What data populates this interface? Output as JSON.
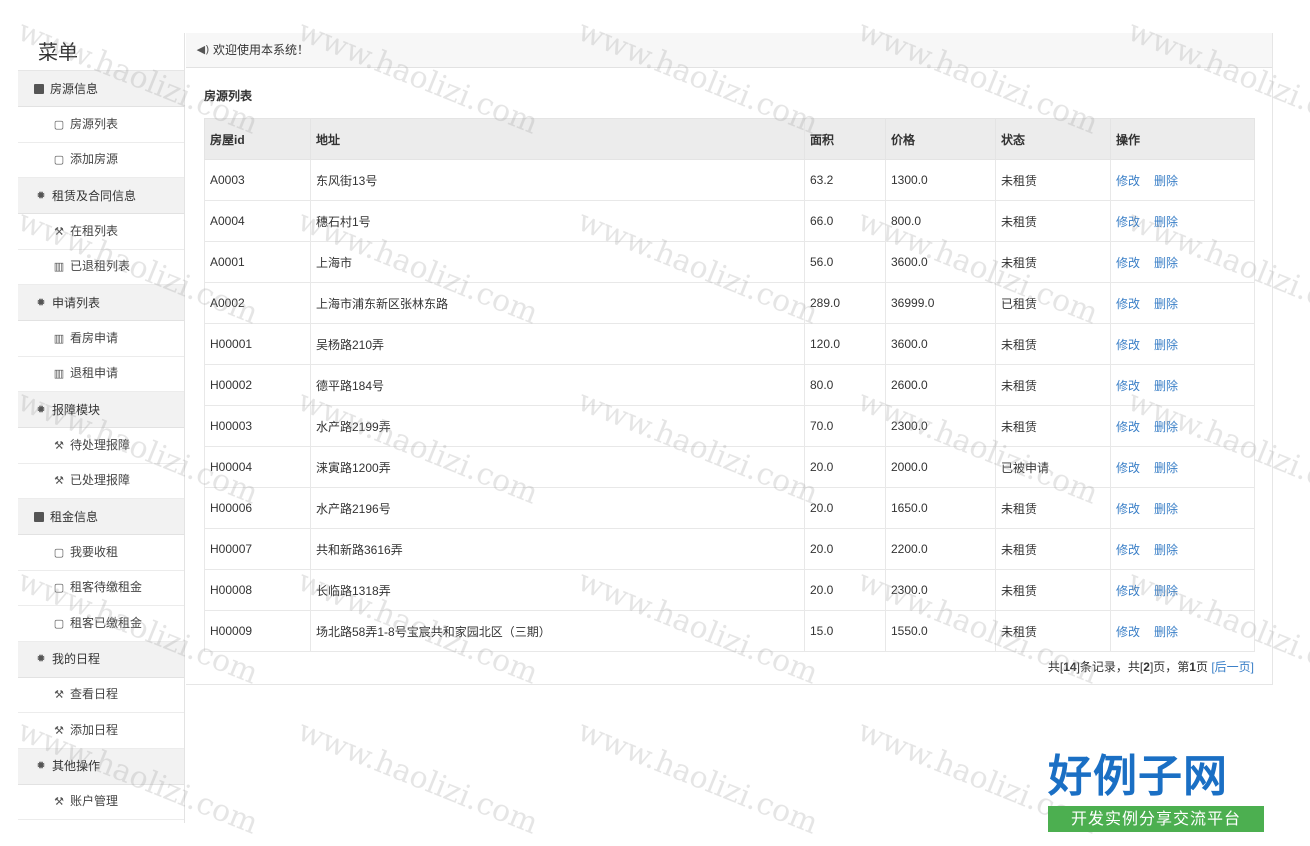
{
  "sidebar": {
    "title": "菜单",
    "groups": [
      {
        "label": "房源信息",
        "items": [
          "房源列表",
          "添加房源"
        ]
      },
      {
        "label": "租赁及合同信息",
        "items": [
          "在租列表",
          "已退租列表"
        ]
      },
      {
        "label": "申请列表",
        "items": [
          "看房申请",
          "退租申请"
        ]
      },
      {
        "label": "报障模块",
        "items": [
          "待处理报障",
          "已处理报障"
        ]
      },
      {
        "label": "租金信息",
        "items": [
          "我要收租",
          "租客待缴租金",
          "租客已缴租金"
        ]
      },
      {
        "label": "我的日程",
        "items": [
          "查看日程",
          "添加日程"
        ]
      },
      {
        "label": "其他操作",
        "items": [
          "账户管理"
        ]
      }
    ]
  },
  "topbar": {
    "welcome": "欢迎使用本系统！"
  },
  "main": {
    "section_title": "房源列表",
    "columns": [
      "房屋id",
      "地址",
      "面积",
      "价格",
      "状态",
      "操作"
    ],
    "rows": [
      [
        "A0003",
        "东风街13号",
        "63.2",
        "1300.0",
        "未租赁"
      ],
      [
        "A0004",
        "穗石村1号",
        "66.0",
        "800.0",
        "未租赁"
      ],
      [
        "A0001",
        "上海市",
        "56.0",
        "3600.0",
        "未租赁"
      ],
      [
        "A0002",
        "上海市浦东新区张林东路",
        "289.0",
        "36999.0",
        "已租赁"
      ],
      [
        "H00001",
        "吴杨路210弄",
        "120.0",
        "3600.0",
        "未租赁"
      ],
      [
        "H00002",
        "德平路184号",
        "80.0",
        "2600.0",
        "未租赁"
      ],
      [
        "H00003",
        "水产路2199弄",
        "70.0",
        "2300.0",
        "未租赁"
      ],
      [
        "H00004",
        "涞寅路1200弄",
        "20.0",
        "2000.0",
        "已被申请"
      ],
      [
        "H00006",
        "水产路2196号",
        "20.0",
        "1650.0",
        "未租赁"
      ],
      [
        "H00007",
        "共和新路3616弄",
        "20.0",
        "2200.0",
        "未租赁"
      ],
      [
        "H00008",
        "长临路1318弄",
        "20.0",
        "2300.0",
        "未租赁"
      ],
      [
        "H00009",
        "场北路58弄1-8号宝宸共和家园北区（三期）",
        "15.0",
        "1550.0",
        "未租赁"
      ]
    ],
    "op_edit": "修改",
    "op_delete": "删除"
  },
  "pager": {
    "prefix": "共[",
    "total": "14",
    "mid1": "]条记录，共[",
    "pages": "2",
    "mid2": "]页，第",
    "current": "1",
    "suffix": "页 ",
    "next": "[后一页]"
  },
  "watermark": "www.haolizi.com",
  "brand": {
    "big": "好例子网",
    "small": "开发实例分享交流平台"
  },
  "colors": {
    "status_leased": "#dd3333",
    "status_applied": "#2a9a2a",
    "link": "#3a7fc7"
  }
}
